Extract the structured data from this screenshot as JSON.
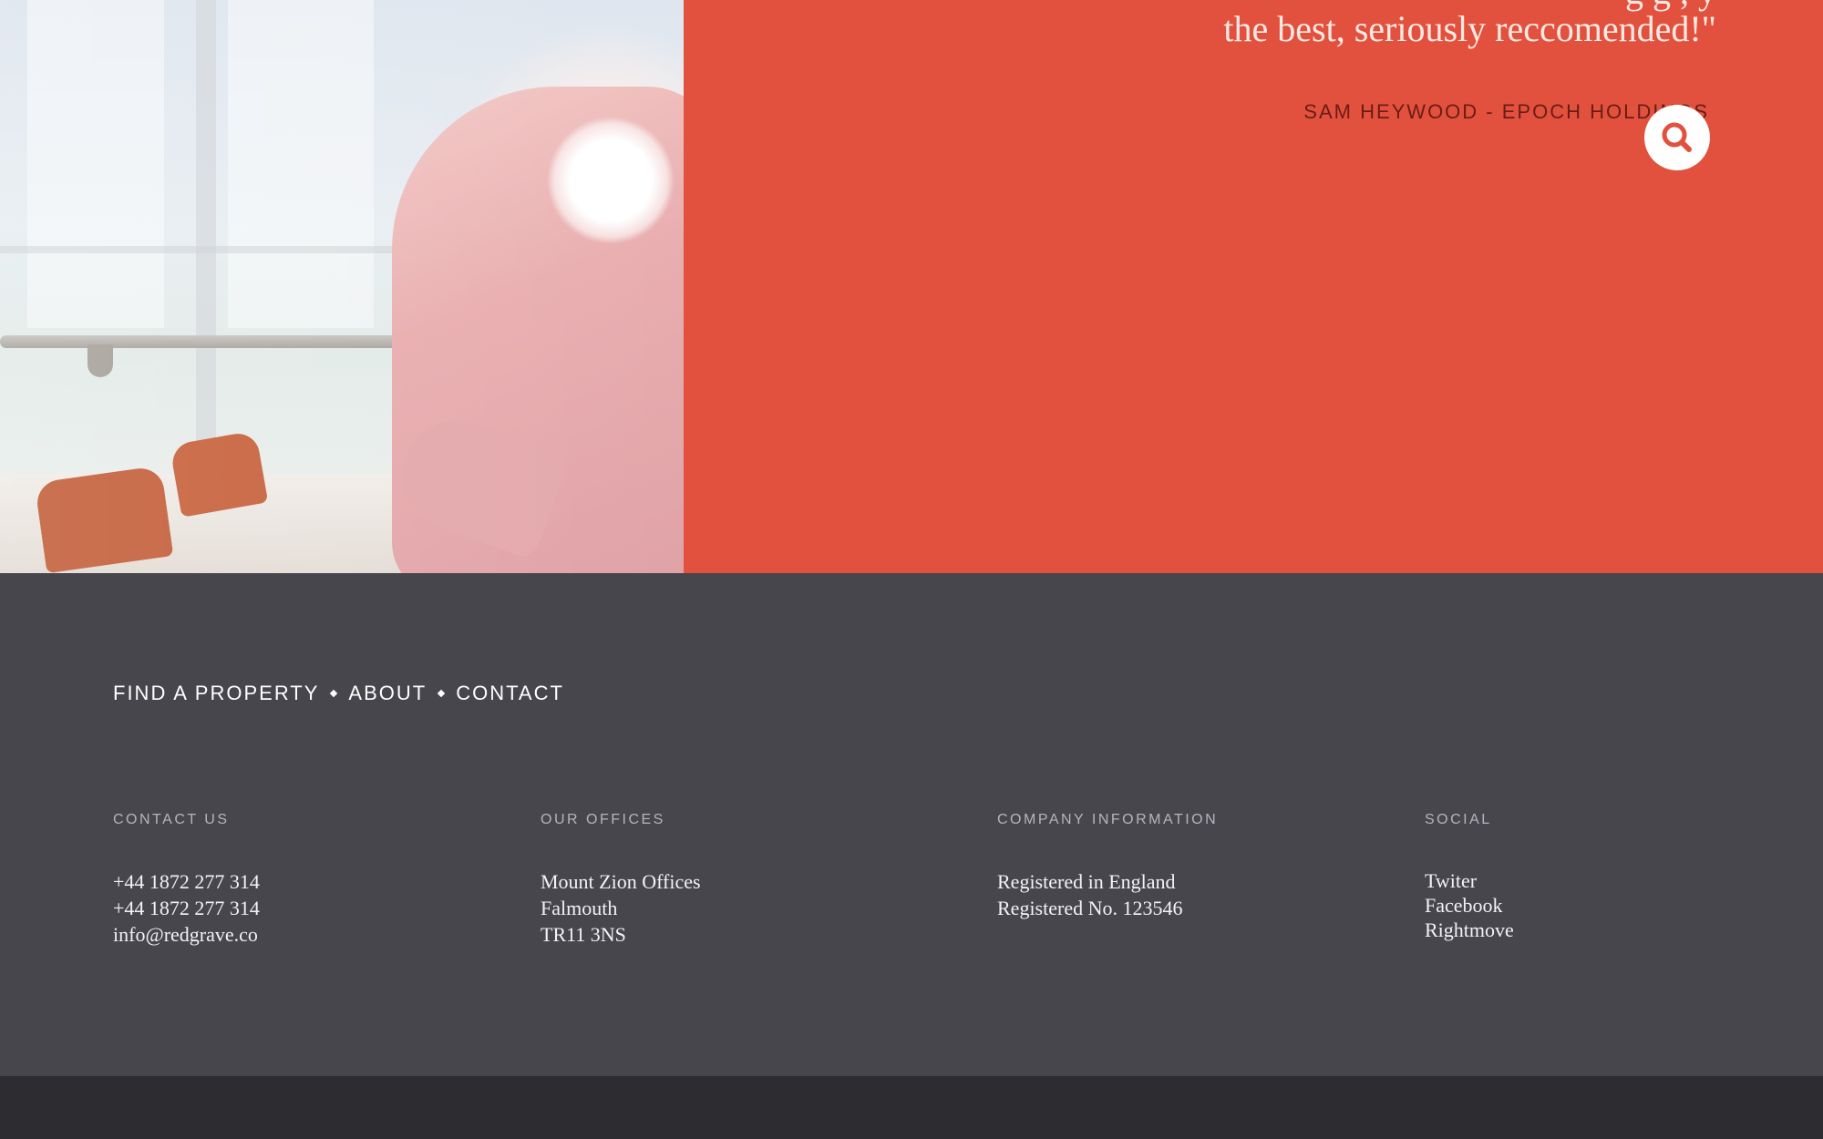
{
  "hero": {
    "quote_line1": "g                                                       g   ,    y",
    "quote_line2": "the best, seriously reccomended!\"",
    "author": "SAM HEYWOOD - EPOCH HOLDINGS",
    "search_icon": "search-icon",
    "accent_color": "#e2513d"
  },
  "footer": {
    "nav": {
      "find_property": "FIND A PROPERTY",
      "about": "ABOUT",
      "contact": "CONTACT"
    },
    "contact": {
      "heading": "CONTACT US",
      "phone1": "+44 1872 277 314",
      "phone2": "+44 1872 277 314",
      "email": "info@redgrave.co"
    },
    "offices": {
      "heading": "OUR OFFICES",
      "line1": "Mount Zion Offices",
      "line2": "Falmouth",
      "line3": "TR11 3NS"
    },
    "company": {
      "heading": "COMPANY INFORMATION",
      "line1": "Registered in England",
      "line2": "Registered No. 123546"
    },
    "social": {
      "heading": "SOCIAL",
      "twitter": "Twiter",
      "facebook": "Facebook",
      "rightmove": "Rightmove"
    }
  }
}
